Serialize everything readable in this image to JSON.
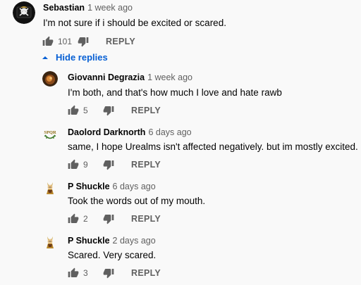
{
  "thread": {
    "top_comment": {
      "author": "Sebastian",
      "time": "1 week ago",
      "text": "I'm not sure if i should be excited or scared.",
      "likes": "101",
      "reply_label": "REPLY",
      "avatar_icon": "skull-flag-avatar"
    },
    "hide_replies_label": "Hide replies",
    "replies": [
      {
        "author": "Giovanni Degrazia",
        "time": "1 week ago",
        "text": "I'm both, and that's how much I love and hate rawb",
        "likes": "5",
        "reply_label": "REPLY",
        "avatar_icon": "photo-avatar"
      },
      {
        "author": "Daolord Darknorth",
        "time": "6 days ago",
        "text": "same, I hope Urealms isn't affected negatively. but im mostly excited.",
        "likes": "9",
        "reply_label": "REPLY",
        "avatar_icon": "spqr-laurel-avatar",
        "avatar_text": "SPQR"
      },
      {
        "author": "P Shuckle",
        "time": "6 days ago",
        "text": "Took the words out of my mouth.",
        "likes": "2",
        "reply_label": "REPLY",
        "avatar_icon": "character-avatar"
      },
      {
        "author": "P Shuckle",
        "time": "2 days ago",
        "text": "Scared. Very scared.",
        "likes": "3",
        "reply_label": "REPLY",
        "avatar_icon": "character-avatar"
      }
    ]
  },
  "colors": {
    "background": "#f9f9f9",
    "text": "#030303",
    "secondary_text": "#606060",
    "link_blue": "#065fd4"
  }
}
